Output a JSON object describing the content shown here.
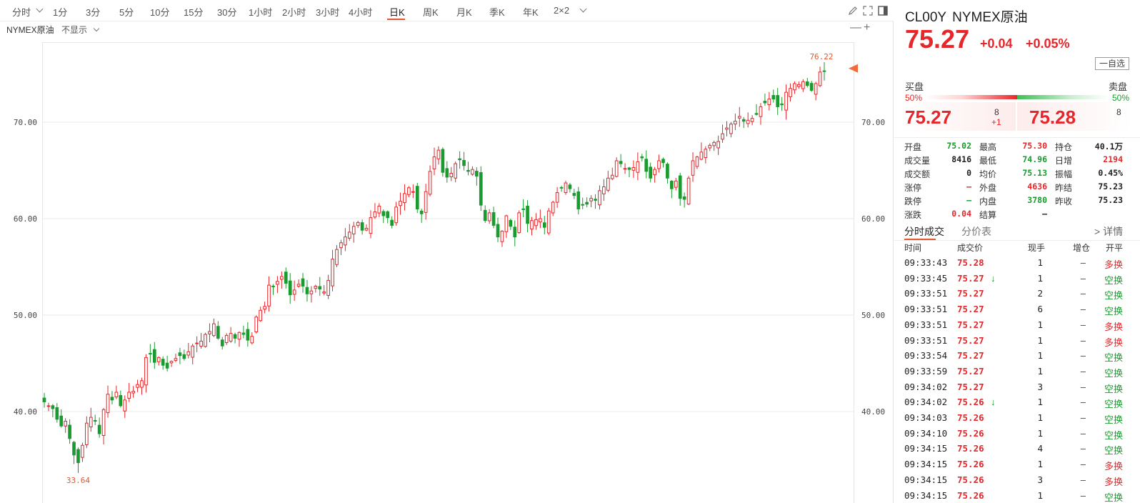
{
  "toolbar": {
    "periods": [
      "分时",
      "1分",
      "3分",
      "5分",
      "10分",
      "15分",
      "30分",
      "1小时",
      "2小时",
      "3小时",
      "4小时",
      "日K",
      "周K",
      "月K",
      "季K",
      "年K",
      "2×2"
    ],
    "active_period": "日K",
    "icons": [
      "pencil-icon",
      "fullscreen-icon",
      "sidebar-toggle-icon"
    ]
  },
  "indicator": {
    "name": "NYMEX原油",
    "select_value": "不显示",
    "minus": "—",
    "plus": "+"
  },
  "chart_data": {
    "type": "candlestick",
    "y_ticks": [
      "70.00",
      "60.00",
      "50.00",
      "40.00"
    ],
    "ylim": [
      32.0,
      77.5
    ],
    "high_label": "76.22",
    "low_label": "33.64",
    "up_color": "#e7262b",
    "down_color": "#1a9b2f",
    "last_price_marker": 75.27,
    "closes": [
      41.0,
      40.6,
      40.3,
      39.2,
      38.5,
      39.0,
      37.2,
      35.5,
      34.7,
      36.5,
      38.8,
      39.4,
      39.0,
      37.7,
      40.2,
      41.8,
      41.2,
      42.0,
      40.6,
      41.2,
      42.0,
      42.1,
      42.8,
      43.2,
      45.6,
      46.0,
      45.1,
      45.6,
      44.8,
      44.5,
      45.2,
      45.5,
      45.8,
      45.5,
      46.2,
      46.8,
      47.1,
      47.3,
      48.0,
      48.3,
      49.1,
      47.6,
      46.8,
      47.9,
      48.1,
      47.6,
      48.2,
      48.0,
      47.4,
      47.8,
      49.8,
      50.5,
      50.9,
      53.1,
      53.0,
      53.5,
      54.0,
      53.3,
      52.1,
      52.6,
      53.2,
      53.0,
      52.2,
      52.5,
      53.0,
      52.7,
      52.4,
      53.6,
      55.8,
      56.8,
      57.5,
      58.1,
      58.6,
      59.2,
      59.6,
      58.8,
      59.0,
      60.1,
      60.7,
      61.3,
      60.3,
      60.1,
      59.3,
      61.2,
      61.8,
      62.6,
      63.2,
      62.8,
      61.0,
      60.5,
      62.8,
      64.9,
      66.4,
      67.1,
      64.8,
      64.3,
      64.7,
      65.7,
      66.1,
      65.5,
      64.9,
      65.1,
      64.4,
      61.4,
      59.8,
      60.6,
      59.3,
      58.1,
      58.7,
      60.3,
      59.2,
      58.1,
      60.6,
      61.0,
      59.5,
      59.8,
      59.9,
      60.0,
      59.1,
      60.8,
      61.7,
      62.7,
      63.2,
      63.7,
      63.1,
      62.4,
      61.0,
      61.4,
      61.5,
      62.1,
      61.9,
      62.9,
      63.3,
      64.2,
      64.5,
      66.0,
      65.7,
      65.2,
      65.1,
      65.3,
      65.9,
      66.3,
      64.9,
      64.2,
      65.1,
      66.0,
      65.8,
      64.2,
      63.1,
      63.9,
      62.1,
      62.0,
      64.2,
      66.0,
      66.4,
      66.9,
      67.2,
      67.6,
      67.9,
      68.0,
      68.8,
      69.4,
      69.8,
      70.1,
      70.6,
      70.1,
      70.2,
      70.4,
      70.8,
      71.6,
      72.0,
      72.4,
      72.4,
      71.6,
      71.8,
      73.1,
      73.5,
      74.0,
      73.9,
      74.2,
      73.8,
      73.3,
      74.0,
      75.2,
      75.27
    ]
  },
  "quote": {
    "code": "CL00Y",
    "name": "NYMEX原油",
    "price": "75.27",
    "change": "+0.04",
    "change_pct": "+0.05%",
    "watch_button": "一自选",
    "bid_label": "买盘",
    "ask_label": "卖盘",
    "bid_pct": "50%",
    "ask_pct": "50%",
    "bid_price": "75.27",
    "bid_vol": "8",
    "bid_delta": "+1",
    "ask_price": "75.28",
    "ask_vol": "8"
  },
  "stats": [
    [
      {
        "l": "开盘",
        "v": "75.02",
        "c": "green"
      },
      {
        "l": "最高",
        "v": "75.30",
        "c": "red"
      },
      {
        "l": "持仓",
        "v": "40.1万",
        "c": "black"
      }
    ],
    [
      {
        "l": "成交量",
        "v": "8416",
        "c": "black"
      },
      {
        "l": "最低",
        "v": "74.96",
        "c": "green"
      },
      {
        "l": "日增",
        "v": "2194",
        "c": "red"
      }
    ],
    [
      {
        "l": "成交额",
        "v": "0",
        "c": "black"
      },
      {
        "l": "均价",
        "v": "75.13",
        "c": "green"
      },
      {
        "l": "振幅",
        "v": "0.45%",
        "c": "black"
      }
    ],
    [
      {
        "l": "涨停",
        "v": "—",
        "c": "red"
      },
      {
        "l": "外盘",
        "v": "4636",
        "c": "red"
      },
      {
        "l": "昨结",
        "v": "75.23",
        "c": "black"
      }
    ],
    [
      {
        "l": "跌停",
        "v": "—",
        "c": "green"
      },
      {
        "l": "内盘",
        "v": "3780",
        "c": "green"
      },
      {
        "l": "昨收",
        "v": "75.23",
        "c": "black"
      }
    ],
    [
      {
        "l": "涨跌",
        "v": "0.04",
        "c": "red"
      },
      {
        "l": "结算",
        "v": "—",
        "c": "black"
      },
      {
        "l": "",
        "v": "",
        "c": "black"
      }
    ]
  ],
  "tabs": {
    "trades": "分时成交",
    "price_table": "分价表",
    "detail": "> 详情"
  },
  "trades_header": [
    "时间",
    "成交价",
    "现手",
    "增仓",
    "开平"
  ],
  "trades": [
    {
      "time": "09:33:43",
      "price": "75.28",
      "arrow": "",
      "hand": "1",
      "oi": "–",
      "type": "多换",
      "tc": "#e7262b"
    },
    {
      "time": "09:33:45",
      "price": "75.27",
      "arrow": "↓",
      "hand": "1",
      "oi": "–",
      "type": "空换",
      "tc": "#1a9b2f"
    },
    {
      "time": "09:33:51",
      "price": "75.27",
      "arrow": "",
      "hand": "2",
      "oi": "–",
      "type": "空换",
      "tc": "#1a9b2f"
    },
    {
      "time": "09:33:51",
      "price": "75.27",
      "arrow": "",
      "hand": "6",
      "oi": "–",
      "type": "空换",
      "tc": "#1a9b2f"
    },
    {
      "time": "09:33:51",
      "price": "75.27",
      "arrow": "",
      "hand": "1",
      "oi": "–",
      "type": "多换",
      "tc": "#e7262b"
    },
    {
      "time": "09:33:51",
      "price": "75.27",
      "arrow": "",
      "hand": "1",
      "oi": "–",
      "type": "多换",
      "tc": "#e7262b"
    },
    {
      "time": "09:33:54",
      "price": "75.27",
      "arrow": "",
      "hand": "1",
      "oi": "–",
      "type": "空换",
      "tc": "#1a9b2f"
    },
    {
      "time": "09:33:59",
      "price": "75.27",
      "arrow": "",
      "hand": "1",
      "oi": "–",
      "type": "空换",
      "tc": "#1a9b2f"
    },
    {
      "time": "09:34:02",
      "price": "75.27",
      "arrow": "",
      "hand": "3",
      "oi": "–",
      "type": "空换",
      "tc": "#1a9b2f"
    },
    {
      "time": "09:34:02",
      "price": "75.26",
      "arrow": "↓",
      "hand": "1",
      "oi": "–",
      "type": "空换",
      "tc": "#1a9b2f"
    },
    {
      "time": "09:34:03",
      "price": "75.26",
      "arrow": "",
      "hand": "1",
      "oi": "–",
      "type": "空换",
      "tc": "#1a9b2f"
    },
    {
      "time": "09:34:10",
      "price": "75.26",
      "arrow": "",
      "hand": "1",
      "oi": "–",
      "type": "空换",
      "tc": "#1a9b2f"
    },
    {
      "time": "09:34:15",
      "price": "75.26",
      "arrow": "",
      "hand": "4",
      "oi": "–",
      "type": "空换",
      "tc": "#1a9b2f"
    },
    {
      "time": "09:34:15",
      "price": "75.26",
      "arrow": "",
      "hand": "1",
      "oi": "–",
      "type": "多换",
      "tc": "#e7262b"
    },
    {
      "time": "09:34:15",
      "price": "75.26",
      "arrow": "",
      "hand": "3",
      "oi": "–",
      "type": "多换",
      "tc": "#e7262b"
    },
    {
      "time": "09:34:15",
      "price": "75.26",
      "arrow": "",
      "hand": "1",
      "oi": "–",
      "type": "空换",
      "tc": "#1a9b2f"
    }
  ]
}
